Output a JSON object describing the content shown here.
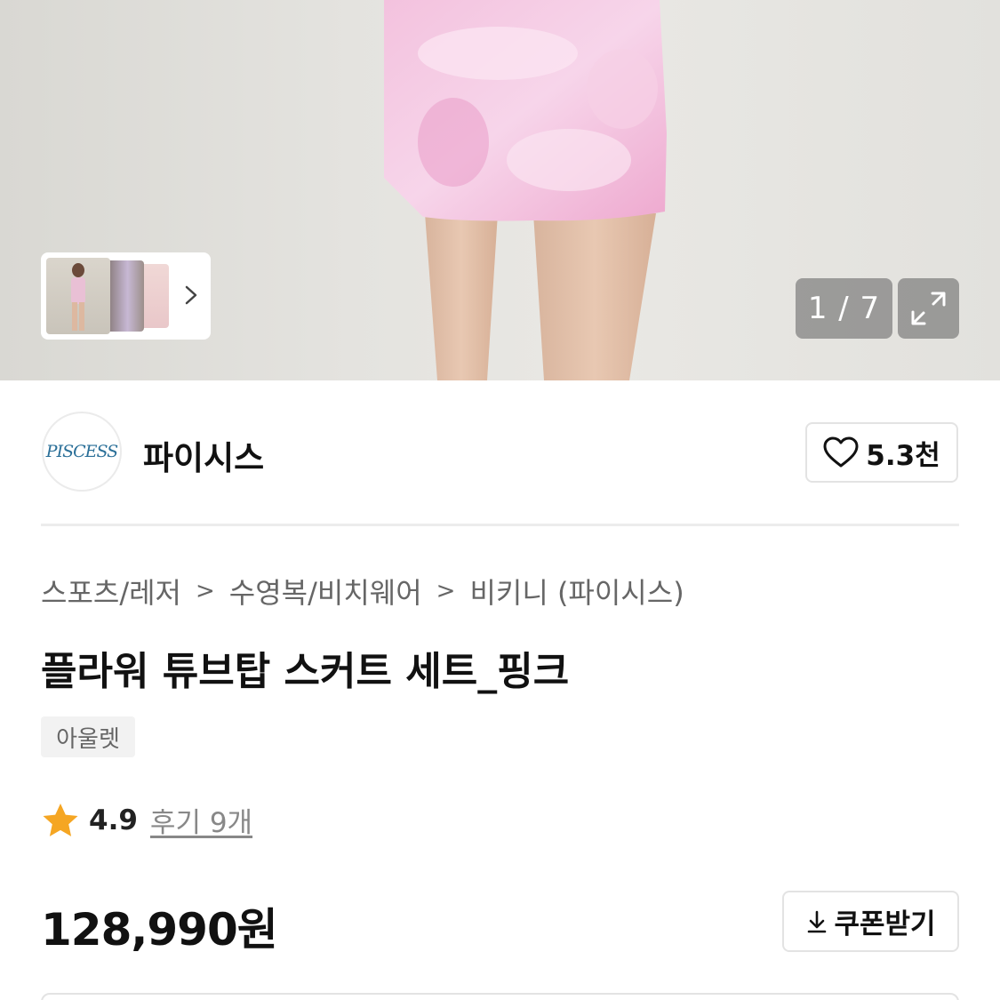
{
  "gallery": {
    "current": 1,
    "total": 7,
    "counter_text": "1 / 7"
  },
  "shop": {
    "logo_text": "PISCESS",
    "name": "파이시스",
    "likes": "5.3천"
  },
  "breadcrumb": [
    "스포츠/레저",
    "수영복/비치웨어",
    "비키니 (파이시스)"
  ],
  "product": {
    "title": "플라워 튜브탑 스커트 세트_핑크",
    "tag": "아울렛",
    "rating": "4.9",
    "reviews": "후기 9개",
    "price": "128,990원"
  },
  "coupon": {
    "label": "쿠폰받기"
  },
  "colors": {
    "star": "#f5a623",
    "logo": "#2a6f98",
    "skirt": "#f0b6d6"
  },
  "icons": [
    "heart-icon",
    "chevron-right-icon",
    "expand-icon",
    "star-icon",
    "download-icon"
  ]
}
